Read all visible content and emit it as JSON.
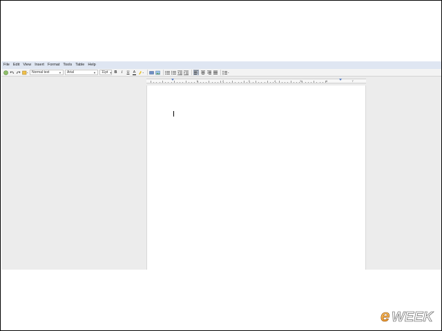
{
  "menu": [
    "File",
    "Edit",
    "View",
    "Insert",
    "Format",
    "Tools",
    "Table",
    "Help"
  ],
  "toolbar": {
    "style_select": "Normal text",
    "font_select": "Arial",
    "size_select": "11pt",
    "bold_label": "B",
    "italic_label": "I",
    "underline_label": "U",
    "text_color_label": "A"
  },
  "ruler": {
    "numbers": [
      "1",
      "2",
      "3",
      "4",
      "5",
      "6",
      "7"
    ]
  },
  "watermark": {
    "brand": "eWEEK"
  },
  "colors": {
    "menubar": "#dfe6f2",
    "workspace": "#ececec",
    "brand_text": "#f2a23a"
  }
}
